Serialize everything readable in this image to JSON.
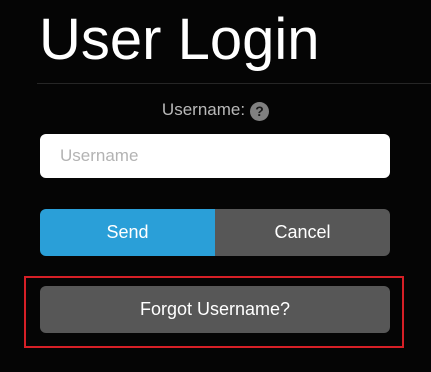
{
  "header": {
    "title": "User Login"
  },
  "form": {
    "username_label": "Username:",
    "help_icon_glyph": "?",
    "username_placeholder": "Username",
    "username_value": ""
  },
  "buttons": {
    "send_label": "Send",
    "cancel_label": "Cancel",
    "forgot_label": "Forgot Username?"
  },
  "colors": {
    "background": "#050505",
    "send_button": "#2a9fd8",
    "secondary_button": "#575757",
    "highlight_border": "#d61f26"
  },
  "icons": {
    "help": "question-circle-icon"
  }
}
